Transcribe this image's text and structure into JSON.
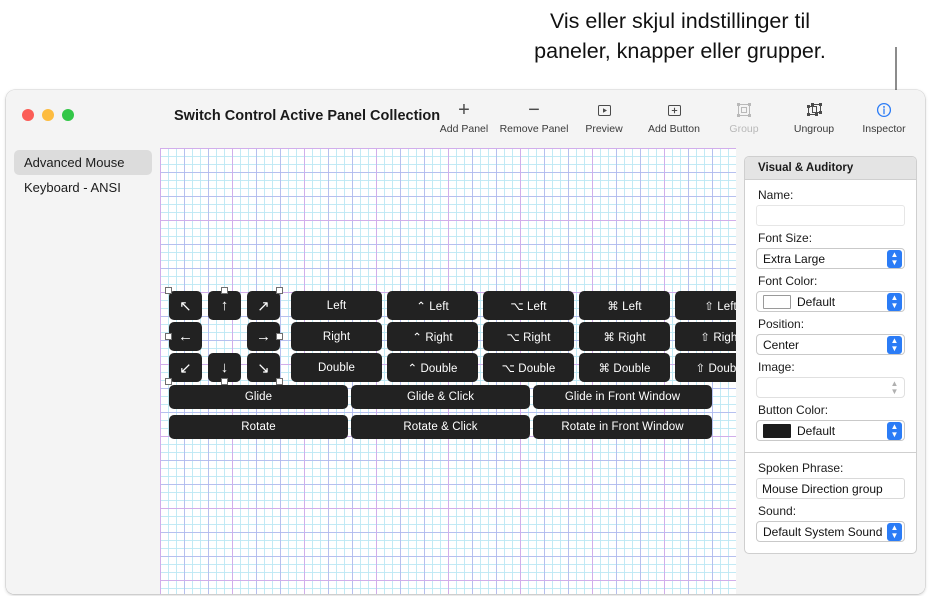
{
  "callout": {
    "line1": "Vis eller skjul indstillinger til",
    "line2": "paneler, knapper eller grupper."
  },
  "window": {
    "title": "Switch Control Active Panel Collection"
  },
  "toolbar": {
    "items": [
      {
        "label": "Add Panel",
        "icon": "plus-icon",
        "state": "enabled"
      },
      {
        "label": "Remove Panel",
        "icon": "minus-icon",
        "state": "enabled"
      },
      {
        "label": "Preview",
        "icon": "play-box-icon",
        "state": "enabled"
      },
      {
        "label": "Add Button",
        "icon": "plus-box-icon",
        "state": "enabled"
      },
      {
        "label": "Group",
        "icon": "group-icon",
        "state": "disabled"
      },
      {
        "label": "Ungroup",
        "icon": "ungroup-icon",
        "state": "enabled"
      },
      {
        "label": "Inspector",
        "icon": "info-circle-icon",
        "state": "active"
      }
    ]
  },
  "sidebar": {
    "items": [
      {
        "label": "Advanced Mouse",
        "selected": true
      },
      {
        "label": "Keyboard - ANSI",
        "selected": false
      }
    ]
  },
  "canvas": {
    "arrow_buttons": [
      {
        "glyph": "↖",
        "name": "arrow-up-left"
      },
      {
        "glyph": "↑",
        "name": "arrow-up"
      },
      {
        "glyph": "↗",
        "name": "arrow-up-right"
      },
      {
        "glyph": "←",
        "name": "arrow-left"
      },
      {
        "glyph": "→",
        "name": "arrow-right"
      },
      {
        "glyph": "↙",
        "name": "arrow-down-left"
      },
      {
        "glyph": "↓",
        "name": "arrow-down"
      },
      {
        "glyph": "↘",
        "name": "arrow-down-right"
      }
    ],
    "click_buttons": [
      "Left",
      "⌃ Left",
      "⌥ Left",
      "⌘ Left",
      "⇧ Left",
      "Right",
      "⌃ Right",
      "⌥ Right",
      "⌘ Right",
      "⇧ Right",
      "Double",
      "⌃ Double",
      "⌥ Double",
      "⌘ Double",
      "⇧ Double"
    ],
    "action_buttons": [
      "Glide",
      "Glide & Click",
      "Glide in Front Window",
      "Rotate",
      "Rotate & Click",
      "Rotate in Front Window"
    ]
  },
  "inspector": {
    "header": "Visual & Auditory",
    "name_label": "Name:",
    "name_value": "",
    "font_size_label": "Font Size:",
    "font_size_value": "Extra Large",
    "font_color_label": "Font Color:",
    "font_color_value": "Default",
    "font_color_swatch": "#ffffff",
    "position_label": "Position:",
    "position_value": "Center",
    "image_label": "Image:",
    "image_value": "",
    "button_color_label": "Button Color:",
    "button_color_value": "Default",
    "button_color_swatch": "#1c1c1c",
    "spoken_phrase_label": "Spoken Phrase:",
    "spoken_phrase_value": "Mouse Direction group",
    "sound_label": "Sound:",
    "sound_value": "Default System Sound"
  }
}
